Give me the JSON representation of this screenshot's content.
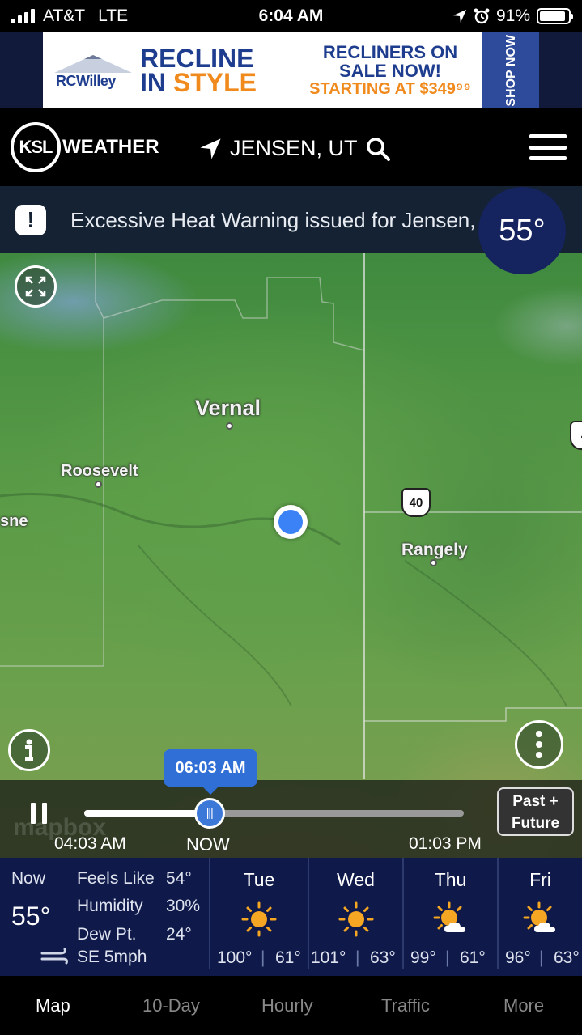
{
  "status": {
    "carrier": "AT&T",
    "network": "LTE",
    "time": "6:04 AM",
    "battery": "91%"
  },
  "ad": {
    "brand": "RCWilley",
    "headline_1": "RECLINE",
    "headline_2a": "IN ",
    "headline_2b": "STYLE",
    "sale_1": "RECLINERS ON",
    "sale_2": "SALE NOW!",
    "sale_3": "STARTING AT $349⁹⁹",
    "cta": "SHOP NOW"
  },
  "header": {
    "logo": "KSL",
    "logo_word": "WEATHER",
    "location": "JENSEN, UT"
  },
  "alert": {
    "text": "Excessive Heat Warning issued for Jensen, UT"
  },
  "current_temp": "55°",
  "map": {
    "cities": [
      "Vernal",
      "Roosevelt",
      "Rangely",
      "sne"
    ],
    "route_shield": "40",
    "route_shield_partial": "4",
    "attribution": "mapbox"
  },
  "timeline": {
    "current_time": "06:03 AM",
    "start_label": "04:03 AM",
    "now_label": "NOW",
    "end_label": "01:03 PM",
    "mode_button": "Past + Future",
    "progress": 0.33
  },
  "conditions": {
    "now_label": "Now",
    "now_temp": "55°",
    "feels_like_label": "Feels Like",
    "feels_like": "54°",
    "humidity_label": "Humidity",
    "humidity": "30%",
    "dew_label": "Dew Pt.",
    "dew": "24°",
    "wind": "SE 5mph"
  },
  "forecast": [
    {
      "day": "Tue",
      "high": "100°",
      "low": "61°",
      "icon": "sunny-icon"
    },
    {
      "day": "Wed",
      "high": "101°",
      "low": "63°",
      "icon": "sunny-icon"
    },
    {
      "day": "Thu",
      "high": "99°",
      "low": "61°",
      "icon": "partly-cloudy-icon"
    },
    {
      "day": "Fri",
      "high": "96°",
      "low": "63°",
      "icon": "partly-cloudy-icon"
    }
  ],
  "tabs": [
    {
      "label": "Map",
      "active": true
    },
    {
      "label": "10-Day",
      "active": false
    },
    {
      "label": "Hourly",
      "active": false
    },
    {
      "label": "Traffic",
      "active": false
    },
    {
      "label": "More",
      "active": false
    }
  ],
  "colors": {
    "brand_navy": "#0f1a4a",
    "accent_blue": "#2f6fd6",
    "alert_bg": "#142233",
    "sun": "#f5a623"
  }
}
